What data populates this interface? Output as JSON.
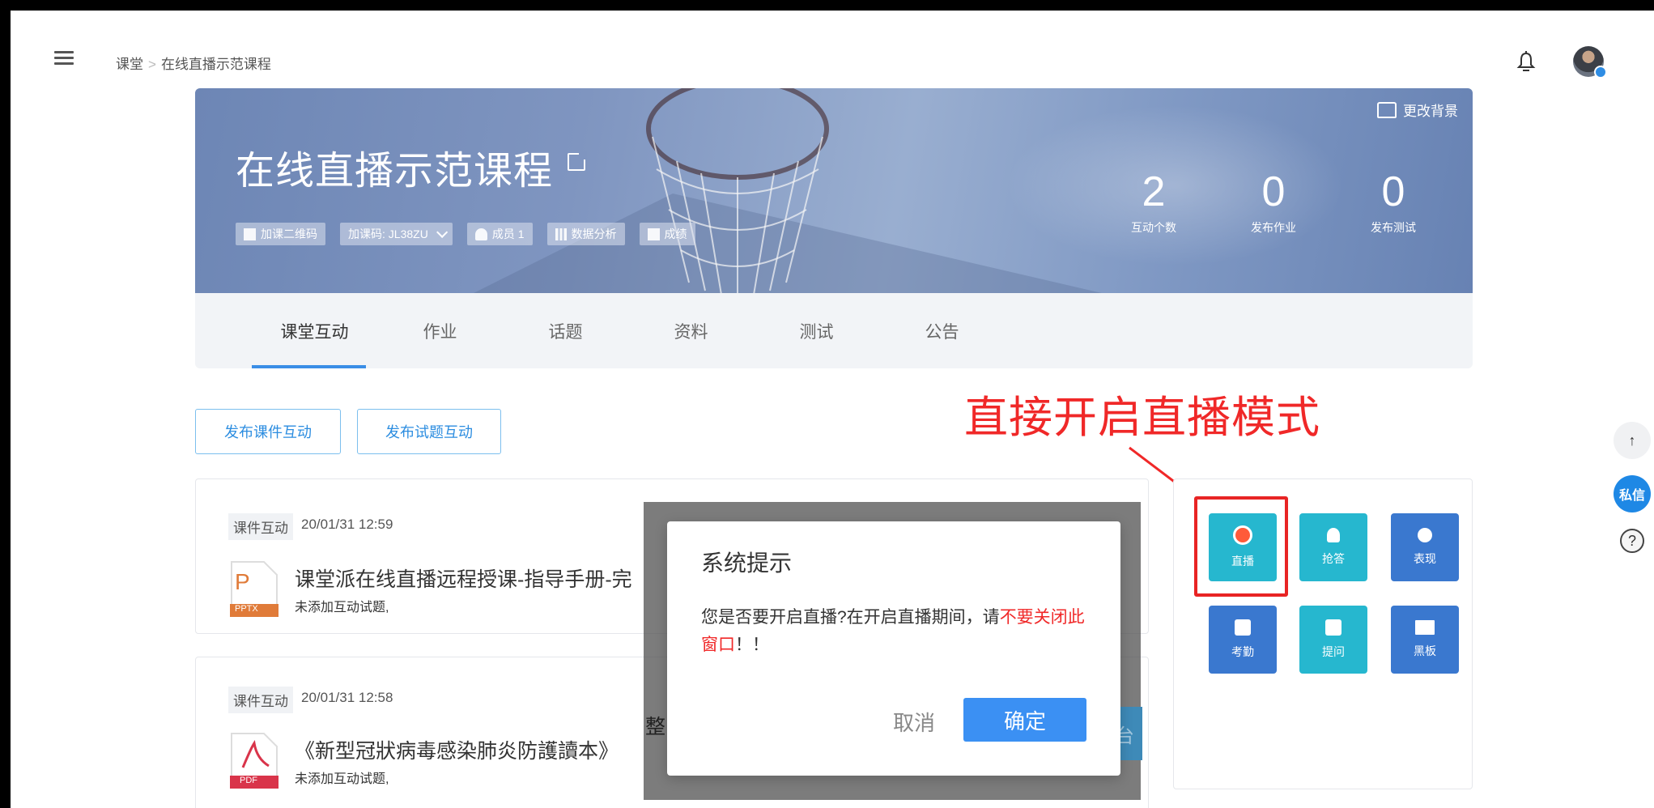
{
  "header": {
    "breadcrumb": [
      "课堂",
      "在线直播示范课程"
    ],
    "breadcrumb_sep": ">"
  },
  "course": {
    "title": "在线直播示范课程",
    "change_bg": "更改背景",
    "chips": [
      {
        "icon": "qrcode-icon",
        "label": "加课二维码"
      },
      {
        "icon": "",
        "label": "加课码: JL38ZU"
      },
      {
        "icon": "member-icon",
        "label": "成员 1"
      },
      {
        "icon": "bar-chart-icon",
        "label": "数据分析"
      },
      {
        "icon": "grade-icon",
        "label": "成绩"
      }
    ],
    "stats": [
      {
        "num": "2",
        "label": "互动个数"
      },
      {
        "num": "0",
        "label": "发布作业"
      },
      {
        "num": "0",
        "label": "发布测试"
      }
    ]
  },
  "tabs": [
    "课堂互动",
    "作业",
    "话题",
    "资料",
    "测试",
    "公告"
  ],
  "actions": {
    "publish_courseware": "发布课件互动",
    "publish_quiz": "发布试题互动"
  },
  "annotation": "直接开启直播模式",
  "items": [
    {
      "tag": "课件互动",
      "date": "20/01/31   12:59",
      "file_type": "PPTX",
      "title": "课堂派在线直播远程授课-指导手册-完",
      "sub": "未添加互动试题,"
    },
    {
      "tag": "课件互动",
      "date": "20/01/31   12:58",
      "file_type": "PDF",
      "title": "《新型冠狀病毒感染肺炎防護讀本》",
      "sub": "未添加互动试题,"
    }
  ],
  "tools": [
    {
      "label": "直播",
      "icon": "live-icon",
      "color": "#26b7cf"
    },
    {
      "label": "抢答",
      "icon": "race-icon",
      "color": "#26b7cf"
    },
    {
      "label": "表现",
      "icon": "medal-icon",
      "color": "#3a78cf"
    },
    {
      "label": "考勤",
      "icon": "calendar-icon",
      "color": "#3a78cf"
    },
    {
      "label": "提问",
      "icon": "question-icon",
      "color": "#26b7cf"
    },
    {
      "label": "黑板",
      "icon": "board-icon",
      "color": "#3a78cf"
    }
  ],
  "dialog": {
    "title": "系统提示",
    "msg_1": "您是否要开启直播?在开启直播期间，请",
    "msg_warn": "不要关闭此窗口",
    "msg_2": "！！",
    "cancel": "取消",
    "ok": "确定"
  },
  "overlay": {
    "left_fragment": "整",
    "right_fragment": "台"
  },
  "side": {
    "up": "↑",
    "message": "私信",
    "help": "?"
  }
}
